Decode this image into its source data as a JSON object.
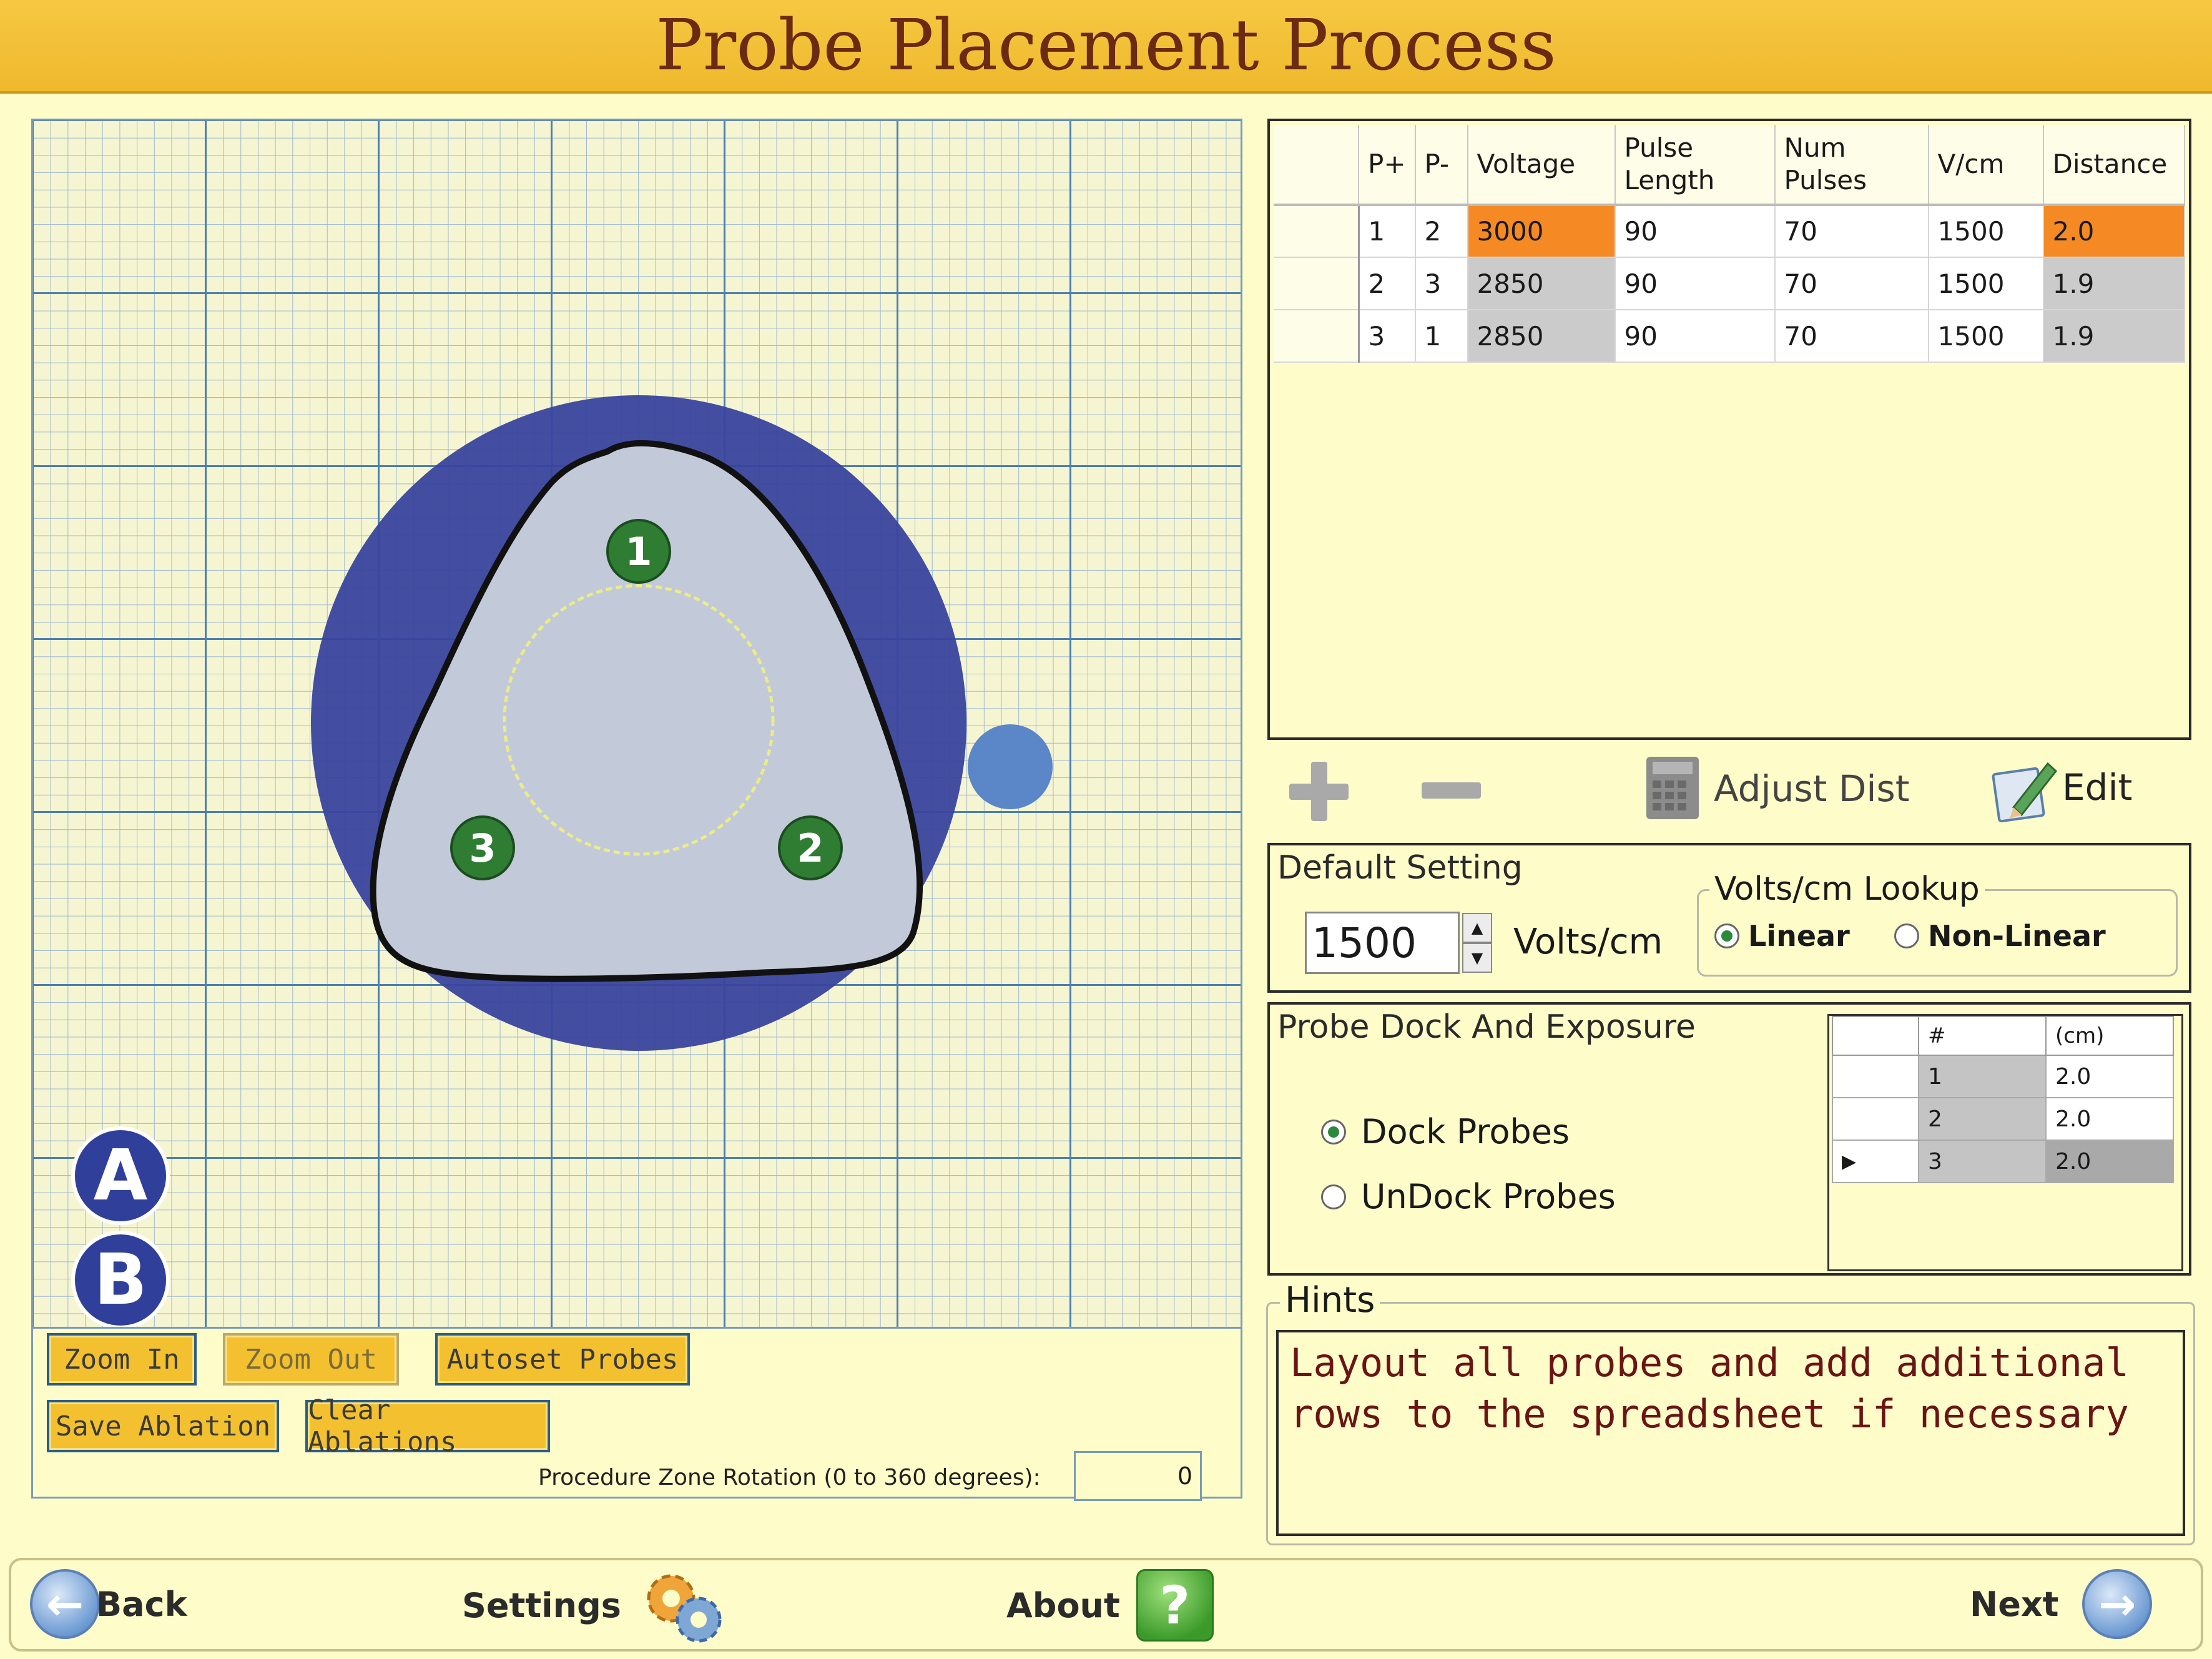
{
  "title": "Probe Placement Process",
  "canvas": {
    "probes": [
      {
        "label": "1"
      },
      {
        "label": "2"
      },
      {
        "label": "3"
      }
    ],
    "markers": [
      "A",
      "B"
    ],
    "buttons": {
      "zoom_in": "Zoom In",
      "zoom_out": "Zoom Out",
      "autoset_probes": "Autoset Probes",
      "save_ablation": "Save Ablation",
      "clear_ablations": "Clear Ablations"
    },
    "rotation": {
      "label": "Procedure Zone Rotation (0 to 360 degrees):",
      "value": "0"
    },
    "colors": {
      "ablation_zone": "#39449e",
      "target_zone": "#bfc6d6",
      "probe": "#2e7d32",
      "external_probe": "#5b86c8"
    }
  },
  "pulse_table": {
    "headers": [
      "P+",
      "P-",
      "Voltage",
      "Pulse Length",
      "Num Pulses",
      "V/cm",
      "Distance"
    ],
    "rows": [
      {
        "p_plus": "1",
        "p_minus": "2",
        "voltage": "3000",
        "pulse_length": "90",
        "num_pulses": "70",
        "v_cm": "1500",
        "distance": "2.0"
      },
      {
        "p_plus": "2",
        "p_minus": "3",
        "voltage": "2850",
        "pulse_length": "90",
        "num_pulses": "70",
        "v_cm": "1500",
        "distance": "1.9"
      },
      {
        "p_plus": "3",
        "p_minus": "1",
        "voltage": "2850",
        "pulse_length": "90",
        "num_pulses": "70",
        "v_cm": "1500",
        "distance": "1.9"
      }
    ]
  },
  "toolbar": {
    "adjust_dist": "Adjust Dist",
    "edit": "Edit"
  },
  "default_setting": {
    "title": "Default Setting",
    "value": "1500",
    "unit": "Volts/cm",
    "lookup": {
      "title": "Volts/cm Lookup",
      "linear": "Linear",
      "non_linear": "Non-Linear",
      "selected": "Linear"
    }
  },
  "probe_dock": {
    "title": "Probe Dock And Exposure",
    "dock": "Dock Probes",
    "undock": "UnDock Probes",
    "selected": "Dock Probes",
    "table": {
      "headers": [
        "#",
        "(cm)"
      ],
      "rows": [
        {
          "num": "1",
          "cm": "2.0"
        },
        {
          "num": "2",
          "cm": "2.0"
        },
        {
          "num": "3",
          "cm": "2.0"
        }
      ]
    }
  },
  "hints": {
    "title": "Hints",
    "text": "Layout all probes and add additional rows to the spreadsheet if necessary"
  },
  "nav": {
    "back": "Back",
    "settings": "Settings",
    "about": "About",
    "next": "Next"
  }
}
